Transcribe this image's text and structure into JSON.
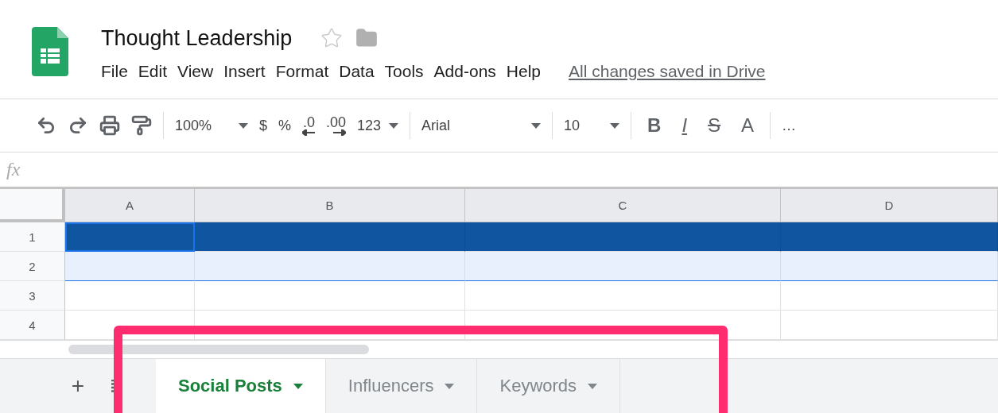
{
  "document": {
    "title": "Thought Leadership",
    "starred": false
  },
  "menu": [
    "File",
    "Edit",
    "View",
    "Insert",
    "Format",
    "Data",
    "Tools",
    "Add-ons",
    "Help"
  ],
  "save_status": "All changes saved in Drive",
  "toolbar": [
    {
      "kind": "icon"
    },
    {
      "kind": "icon"
    },
    {
      "kind": "icon"
    },
    {
      "kind": "icon"
    },
    {
      "kind": "divider"
    },
    {
      "kind": "dropdown",
      "label": "100%"
    },
    {
      "kind": "text",
      "label": "$"
    },
    {
      "kind": "text",
      "label": "%"
    },
    {
      "kind": "decimal",
      "label": ".0"
    },
    {
      "kind": "decimal",
      "label": ".00"
    },
    {
      "kind": "dropdown",
      "label": "123"
    },
    {
      "kind": "divider"
    },
    {
      "kind": "dropdown",
      "label": "Arial"
    },
    {
      "kind": "divider"
    },
    {
      "kind": "dropdown",
      "label": "10"
    },
    {
      "kind": "divider"
    },
    {
      "kind": "style",
      "label": "B"
    },
    {
      "kind": "style",
      "label": "I"
    },
    {
      "kind": "style",
      "label": "S"
    },
    {
      "kind": "style",
      "label": "A"
    },
    {
      "kind": "divider"
    },
    {
      "kind": "text",
      "label": "…"
    }
  ],
  "formula_bar": {
    "label": "fx"
  },
  "columns": [
    {
      "label": "A"
    },
    {
      "label": "B"
    },
    {
      "label": "C"
    },
    {
      "label": "D"
    }
  ],
  "rows": [
    {
      "label": "1",
      "kind": "dark",
      "cells": [
        {
          "active": true
        },
        {
          "active": false
        },
        {
          "active": false
        },
        {
          "active": false
        }
      ]
    },
    {
      "label": "2",
      "kind": "light",
      "cells": [
        {
          "active": false
        },
        {
          "active": false
        },
        {
          "active": false
        },
        {
          "active": false
        }
      ]
    },
    {
      "label": "3",
      "kind": "plain",
      "cells": [
        {
          "active": false
        },
        {
          "active": false
        },
        {
          "active": false
        },
        {
          "active": false
        }
      ]
    },
    {
      "label": "4",
      "kind": "plain",
      "cells": [
        {
          "active": false
        },
        {
          "active": false
        },
        {
          "active": false
        },
        {
          "active": false
        }
      ]
    }
  ],
  "sheet_controls": {
    "add": "+"
  },
  "sheets": [
    {
      "label": "Social Posts",
      "selected": true
    },
    {
      "label": "Influencers",
      "selected": false
    },
    {
      "label": "Keywords",
      "selected": false
    }
  ]
}
